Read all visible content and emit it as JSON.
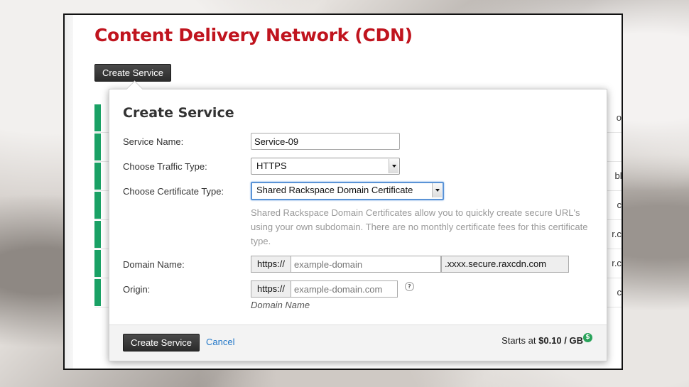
{
  "page": {
    "title": "Content Delivery Network (CDN)",
    "create_button": "Create Service",
    "row_fragments": [
      "ome",
      "",
      "ble.c",
      "com",
      "r.com",
      "r.com",
      "com"
    ]
  },
  "modal": {
    "title": "Create Service",
    "service_name": {
      "label": "Service Name:",
      "value": "Service-09"
    },
    "traffic_type": {
      "label": "Choose Traffic Type:",
      "value": "HTTPS"
    },
    "certificate_type": {
      "label": "Choose Certificate Type:",
      "value": "Shared Rackspace Domain Certificate"
    },
    "certificate_help": "Shared Rackspace Domain Certificates allow you to quickly create secure URL's using your own subdomain. There are no monthly certificate fees for this certificate type.",
    "domain_name": {
      "label": "Domain Name:",
      "prefix": "https://",
      "placeholder": "example-domain",
      "suffix": ".xxxx.secure.raxcdn.com"
    },
    "origin": {
      "label": "Origin:",
      "prefix": "https://",
      "placeholder": "example-domain.com",
      "hint": "Domain Name",
      "help_icon": "?"
    },
    "footer": {
      "submit_label": "Create Service",
      "cancel_label": "Cancel",
      "price_prefix": "Starts at",
      "price_value": "$0.10 / GB",
      "price_icon": "$"
    }
  },
  "colors": {
    "title_red": "#c0141e",
    "status_green": "#1aa165",
    "link_blue": "#2277c8",
    "focus_blue": "#5a93d6"
  }
}
